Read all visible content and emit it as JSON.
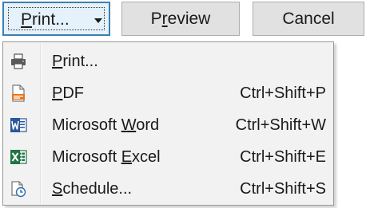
{
  "toolbar": {
    "print_button": {
      "before": "",
      "key": "P",
      "after": "rint..."
    },
    "preview_button": {
      "before": "P",
      "key": "r",
      "after": "eview"
    },
    "cancel_label": "Cancel"
  },
  "menu": {
    "items": [
      {
        "before": "",
        "key": "P",
        "after": "rint...",
        "shortcut": "",
        "icon": "printer-icon"
      },
      {
        "before": "",
        "key": "P",
        "after": "DF",
        "shortcut": "Ctrl+Shift+P",
        "icon": "pdf-icon"
      },
      {
        "before": "Microsoft ",
        "key": "W",
        "after": "ord",
        "shortcut": "Ctrl+Shift+W",
        "icon": "word-icon"
      },
      {
        "before": "Microsoft ",
        "key": "E",
        "after": "xcel",
        "shortcut": "Ctrl+Shift+E",
        "icon": "excel-icon"
      },
      {
        "before": "",
        "key": "S",
        "after": "chedule...",
        "shortcut": "Ctrl+Shift+S",
        "icon": "schedule-icon"
      }
    ]
  },
  "colors": {
    "pdf_orange": "#e8741b",
    "word_blue": "#2b579a",
    "excel_green": "#217346",
    "focus_blue": "#3c7fb1"
  }
}
